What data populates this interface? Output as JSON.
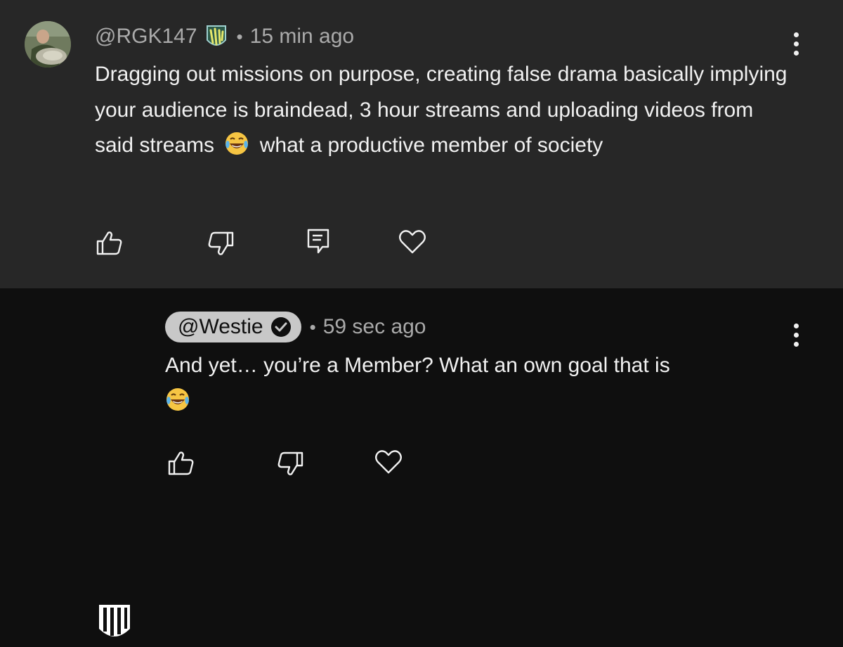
{
  "comments": [
    {
      "handle": "@RGK147",
      "time": "15 min ago",
      "separator": "•",
      "text_before_emoji": "Dragging out missions on purpose, creating false drama basically implying your audience is braindead, 3 hour streams and uploading videos from said streams",
      "emoji": "face-with-tears-of-joy",
      "text_after_emoji": "what a productive member of society",
      "actions": [
        "thumbs-up-icon",
        "thumbs-down-icon",
        "reply-icon",
        "heart-icon"
      ]
    },
    {
      "handle": "@Westie",
      "verified": true,
      "time": "59 sec ago",
      "separator": "•",
      "text": "And yet… you’re a Member? What an own goal that is",
      "emoji": "face-with-tears-of-joy",
      "actions": [
        "thumbs-up-icon",
        "thumbs-down-icon",
        "heart-icon"
      ]
    }
  ],
  "colors": {
    "top_background": "#272727",
    "reply_background": "#0f0f0f",
    "text": "#f1f1f1",
    "meta": "#aaaaaa",
    "creator_chip": "#c8c8c8"
  }
}
